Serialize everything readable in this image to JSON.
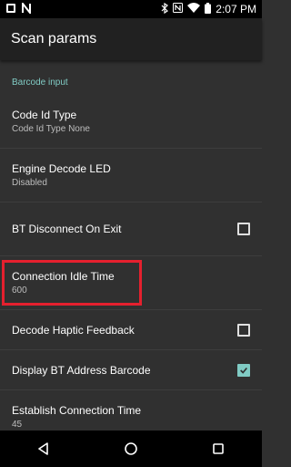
{
  "status_bar": {
    "time": "2:07 PM",
    "icons_left": [
      "notification-icon",
      "n-logo-icon"
    ],
    "icons_right": [
      "bluetooth-icon",
      "nfc-icon",
      "wifi-icon",
      "battery-icon"
    ]
  },
  "app_bar": {
    "title": "Scan params"
  },
  "list": {
    "category": "Barcode input",
    "items": [
      {
        "title": "Code Id Type",
        "summary": "Code Id Type None"
      },
      {
        "title": "Engine Decode LED",
        "summary": "Disabled"
      },
      {
        "title": "BT Disconnect On Exit",
        "checked": false
      },
      {
        "title": "Connection Idle Time",
        "summary": "600"
      },
      {
        "title": "Decode Haptic Feedback",
        "checked": false
      },
      {
        "title": "Display BT Address Barcode",
        "checked": true
      },
      {
        "title": "Establish Connection Time",
        "summary": "45"
      }
    ]
  },
  "colors": {
    "accent": "#80cbc4",
    "highlight": "#e5202e",
    "background": "#303030",
    "app_bar": "#212121"
  },
  "nav_bar": {
    "icons": [
      "back-icon",
      "home-icon",
      "recents-icon"
    ]
  }
}
